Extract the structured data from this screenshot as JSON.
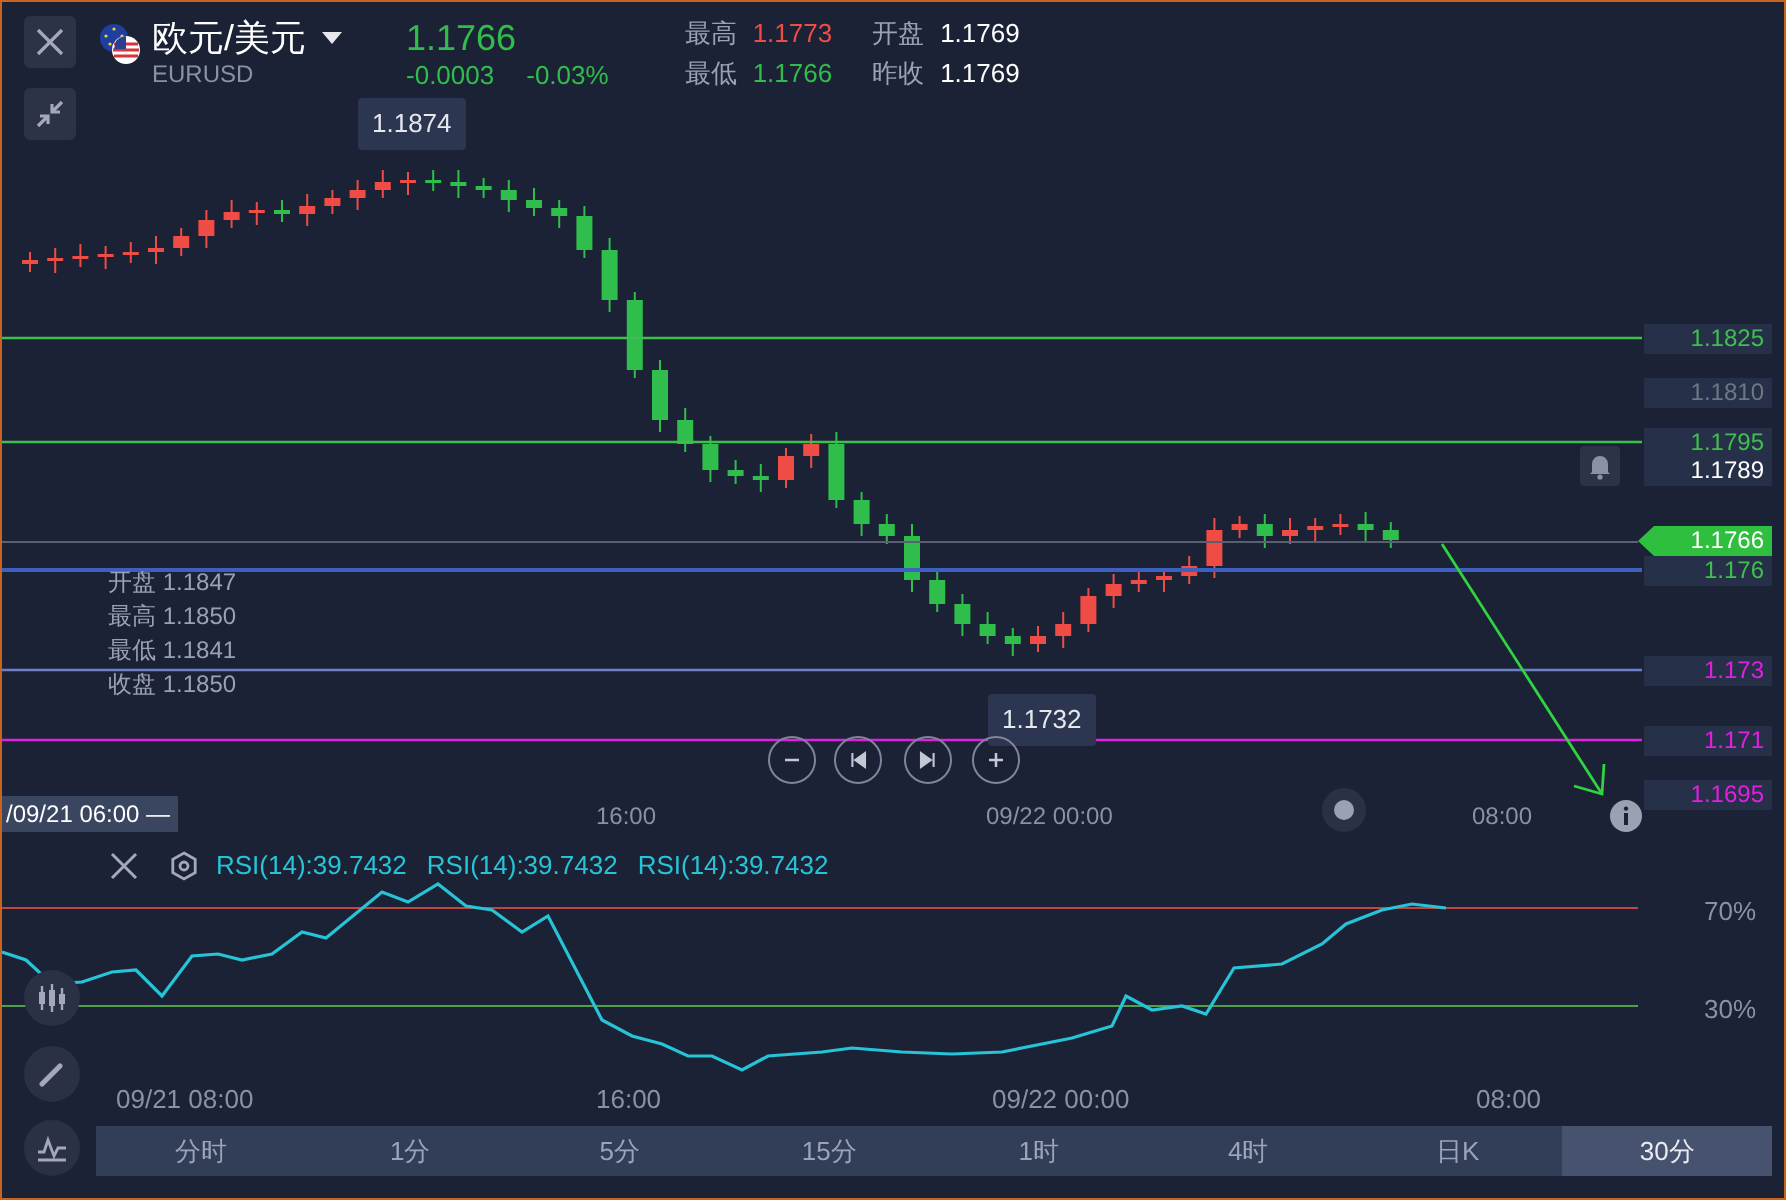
{
  "header": {
    "pair": "欧元/美元",
    "symbol": "EURUSD",
    "price": "1.1766",
    "change": "-0.0003",
    "change_percent": "-0.03%",
    "stats": [
      {
        "label": "最高",
        "value": "1.1773",
        "color": "#ee4c45"
      },
      {
        "label": "开盘",
        "value": "1.1769",
        "color": "#ffffff"
      },
      {
        "label": "最低",
        "value": "1.1766",
        "color": "#2fbd4b"
      },
      {
        "label": "昨收",
        "value": "1.1769",
        "color": "#ffffff"
      }
    ]
  },
  "chart": {
    "high_marker": "1.1874",
    "low_marker": "1.1732",
    "ohlc": [
      {
        "label": "开盘",
        "value": "1.1847"
      },
      {
        "label": "最高",
        "value": "1.1850"
      },
      {
        "label": "最低",
        "value": "1.1841"
      },
      {
        "label": "收盘",
        "value": "1.1850"
      }
    ],
    "price_levels": [
      {
        "kind": "line",
        "text": "1.1825",
        "color": "#3fbf4f"
      },
      {
        "kind": "tick",
        "text": "1.1810",
        "color": "#6f7686"
      },
      {
        "kind": "line",
        "text": "1.1795",
        "color": "#3fbf4f"
      },
      {
        "kind": "tick",
        "text": "1.1789",
        "color": "#ffffff"
      },
      {
        "kind": "current",
        "text": "1.1766",
        "color": "#2fbf3f"
      },
      {
        "kind": "guide",
        "text": "1.176",
        "color": "#3fbf4f"
      },
      {
        "kind": "guide",
        "text": "1.173",
        "color": "#e020e0"
      },
      {
        "kind": "line",
        "text": "1.171",
        "color": "#e020e0"
      },
      {
        "kind": "tick",
        "text": "1.1695",
        "color": "#e020e0"
      }
    ],
    "crosshair_time": "/09/21 06:00 —",
    "time_axis": [
      "16:00",
      "09/22 00:00",
      "08:00"
    ]
  },
  "rsi": {
    "labels": [
      "RSI(14):39.7432",
      "RSI(14):39.7432",
      "RSI(14):39.7432"
    ],
    "levels": [
      "70%",
      "30%"
    ],
    "time_axis": [
      "09/21 08:00",
      "16:00",
      "09/22 00:00",
      "08:00"
    ]
  },
  "timeframes": [
    {
      "label": "分时",
      "selected": false
    },
    {
      "label": "1分",
      "selected": false
    },
    {
      "label": "5分",
      "selected": false
    },
    {
      "label": "15分",
      "selected": false
    },
    {
      "label": "1时",
      "selected": false
    },
    {
      "label": "4时",
      "selected": false
    },
    {
      "label": "日K",
      "selected": false
    },
    {
      "label": "30分",
      "selected": true
    }
  ]
}
